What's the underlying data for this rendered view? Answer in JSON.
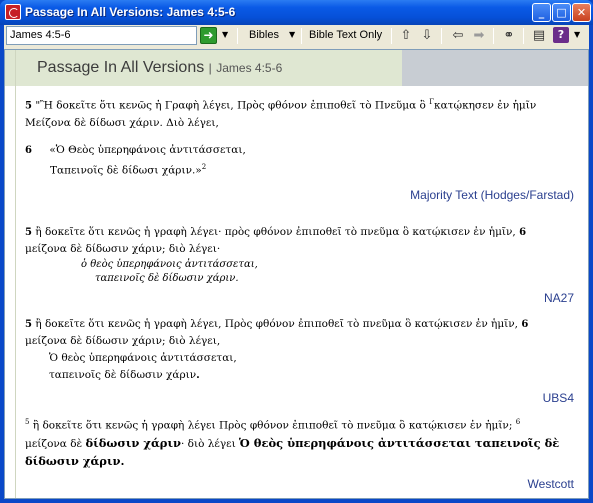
{
  "window": {
    "title": "Passage In All Versions: James 4:5-6",
    "controls": {
      "minimize": "_",
      "maximize": "□",
      "close": "✕"
    }
  },
  "toolbar": {
    "reference_value": "James 4:5-6",
    "go_icon": "go-arrow-icon",
    "bibles_label": "Bibles",
    "bible_text_only_label": "Bible Text Only",
    "icons": [
      "arrow-up-icon",
      "arrow-down-icon",
      "back-icon",
      "forward-icon",
      "link-icon",
      "options-icon",
      "help-icon"
    ]
  },
  "header": {
    "title": "Passage In All Versions",
    "separator": "|",
    "reference": "James 4:5-6"
  },
  "versions": [
    {
      "name": "Majority Text (Hodges/Farstad)",
      "line1_num": "5",
      "line1": "\"Ἢ δοκεῖτε ὅτι κενῶς ἡ Γραφὴ λέγει, Πρὸς φθόνον ἐπιποθεῖ τὸ Πνεῦμα ὃ ",
      "line1_mark": "Γ",
      "line1_end": "κατῴκησεν ἐν ἡμῖν",
      "line2": "Μείζονα δὲ δίδωσι χάριν. Διὸ λέγει,",
      "quote_num": "6",
      "quote1": "«Ὁ Θεὸς ὑπερηφάνοις ἀντιτάσσεται,",
      "quote2": "Ταπεινοῖς δὲ δίδωσι χάριν.»",
      "footnote": "2"
    },
    {
      "name": "NA27",
      "num5": "5",
      "line1": "ἢ δοκεῖτε ὅτι κενῶς ἡ γραφὴ λέγει· πρὸς φθόνον ἐπιποθεῖ τὸ πνεῦμα ὃ κατῴκισεν ἐν ἡμῖν,",
      "num6": "6",
      "line2": "μείζονα δὲ δίδωσιν χάριν; διὸ λέγει·",
      "quote1": "ὁ θεὸς ὑπερηφάνοις ἀντιτάσσεται,",
      "quote2": "ταπεινοῖς δὲ δίδωσιν χάριν."
    },
    {
      "name": "UBS4",
      "num5": "5",
      "line1": "ἢ δοκεῖτε ὅτι κενῶς ἡ γραφὴ λέγει, Πρὸς φθόνον ἐπιποθεῖ τὸ πνεῦμα ὃ κατῴκισεν ἐν ἡμῖν,",
      "num6": "6",
      "line2": "μείζονα δὲ δίδωσιν χάριν; διὸ λέγει,",
      "quote1": "Ὁ θεὸς ὑπερηφάνοις ἀντιτάσσεται,",
      "quote2": "ταπεινοῖς δὲ δίδωσιν χάριν",
      "quote2_end": "."
    },
    {
      "name": "Westcott",
      "num5": "5",
      "line1": "ἢ δοκεῖτε ὅτι κενῶς ἡ γραφὴ λέγει Πρὸς φθόνον ἐπιποθεῖ τὸ πνεῦμα ὃ κατῴκισεν ἐν ἡμῖν;",
      "num6": "6",
      "line2a": "μείζονα δὲ ",
      "line2b": "δίδωσιν χάριν",
      "line2c": "· διὸ λέγει ",
      "line2d": "Ὁ θεὸς ὑπερηφάνοις ἀντιτάσσεται ταπεινοῖς δὲ",
      "line3": "δίδωσιν χάριν."
    }
  ]
}
